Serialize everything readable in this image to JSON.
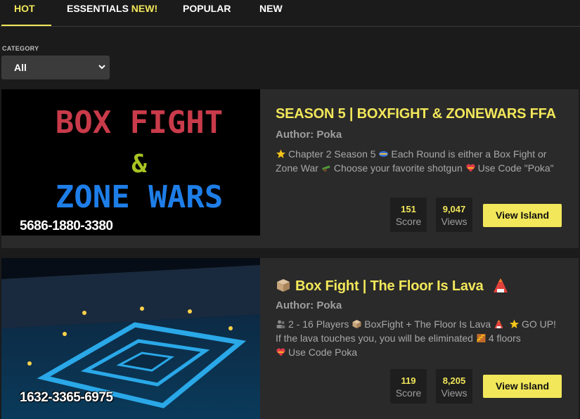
{
  "tabs": [
    {
      "label": "HOT",
      "active": true
    },
    {
      "label": "ESSENTIALS",
      "badge": "NEW!",
      "active": false
    },
    {
      "label": "POPULAR",
      "active": false
    },
    {
      "label": "NEW",
      "active": false
    }
  ],
  "category": {
    "label": "CATEGORY",
    "selected": "All"
  },
  "colors": {
    "accent": "#f2e75a",
    "card_bg": "#2a2a2a",
    "page_bg": "#1b1b1b"
  },
  "islands": [
    {
      "thumbnail": {
        "line1": "BOX FIGHT",
        "line2": "&",
        "line3": "ZONE WARS",
        "code": "5686-1880-3380"
      },
      "title": "SEASON 5 | BOXFIGHT & ZONEWARS FFA",
      "author": "Author: Poka",
      "description": [
        {
          "icon": "star-icon",
          "text": "Chapter 2 Season 5"
        },
        {
          "icon": "crossed-swords-icon",
          "text": "Each Round is either a Box Fight or Zone War"
        },
        {
          "icon": "shotgun-icon",
          "text": "Choose your favorite shotgun"
        },
        {
          "icon": "heart-icon",
          "text": "Use Code \"Poka\""
        }
      ],
      "score": "151",
      "score_label": "Score",
      "views": "9,047",
      "views_label": "Views",
      "button": "View Island"
    },
    {
      "thumbnail": {
        "code": "1632-3365-6975"
      },
      "title_icon_left": "box-icon",
      "title": "Box Fight | The Floor Is Lava",
      "title_icon_right": "volcano-icon",
      "author": "Author: Poka",
      "description": [
        {
          "icon": "players-icon",
          "text": "2 - 16 Players"
        },
        {
          "icon": "box-icon",
          "text": "BoxFight + The Floor Is Lava"
        },
        {
          "icon": "volcano-icon",
          "text": ""
        },
        {
          "icon": "star-icon",
          "text": "GO UP! If the lava touches you, you will be eliminated"
        },
        {
          "icon": "stairs-icon",
          "text": "4 floors"
        },
        {
          "icon": "heart-icon",
          "text": "Use Code Poka"
        }
      ],
      "score": "119",
      "score_label": "Score",
      "views": "8,205",
      "views_label": "Views",
      "button": "View Island"
    }
  ]
}
